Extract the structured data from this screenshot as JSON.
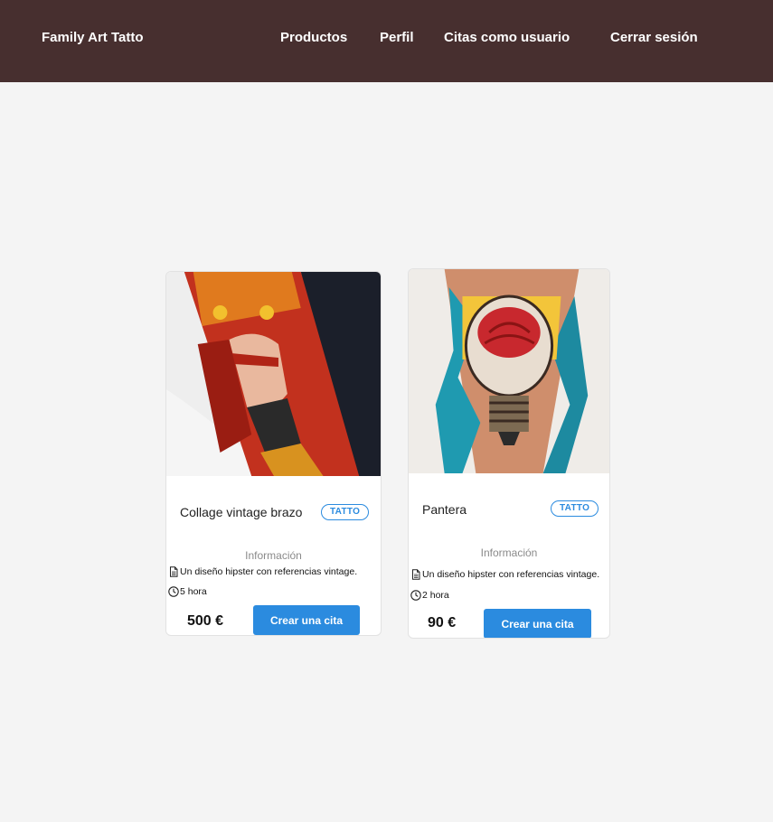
{
  "navbar": {
    "brand": "Family Art Tatto",
    "links": [
      "Productos",
      "Perfil",
      "Citas como usuario",
      "Cerrar sesión"
    ]
  },
  "products": [
    {
      "title": "Collage vintage brazo",
      "badge": "TATTO",
      "info_heading": "Información",
      "description": "Un diseño hipster con referencias vintage.",
      "duration": "5 hora",
      "price": "500 €",
      "button": "Crear una cita",
      "image_icon": "tattoo-photo-woman-tiger"
    },
    {
      "title": "Pantera",
      "badge": "TATTO",
      "info_heading": "Información",
      "description": "Un diseño hipster con referencias vintage.",
      "duration": "2 hora",
      "price": "90 €",
      "button": "Crear una cita",
      "image_icon": "tattoo-photo-lightbulb-brain"
    }
  ],
  "colors": {
    "navbar_bg": "#472f2f",
    "page_bg": "#f4f4f4",
    "accent": "#2b8bdf"
  }
}
